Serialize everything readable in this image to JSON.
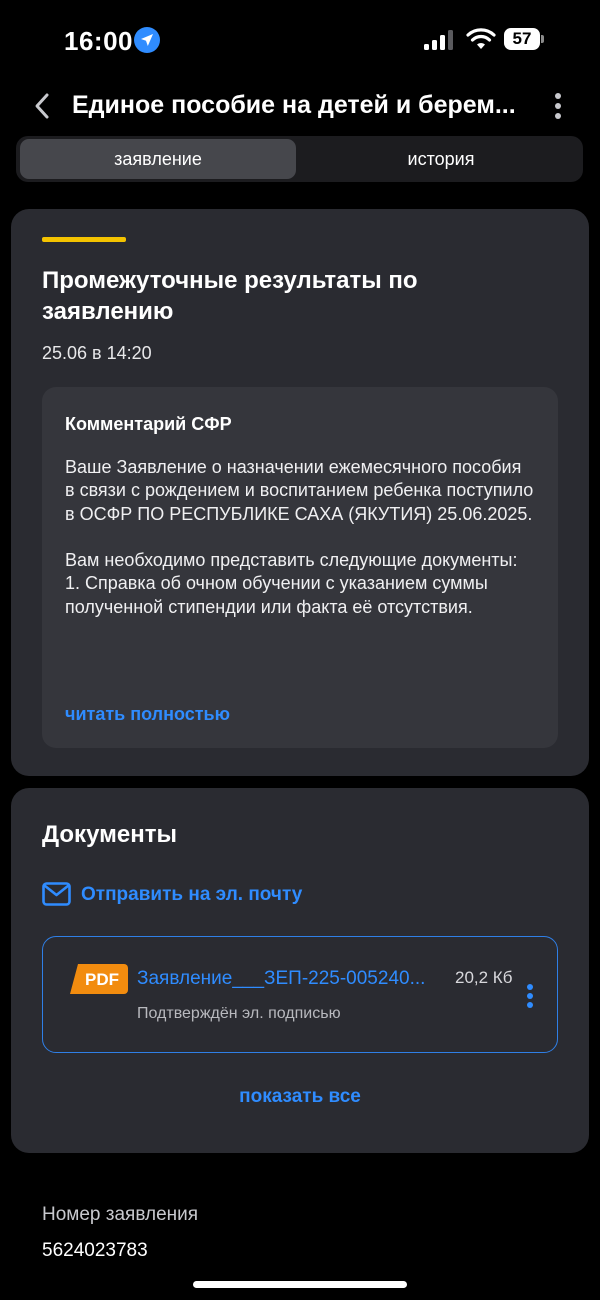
{
  "status_bar": {
    "time": "16:00",
    "battery": "57",
    "icons": [
      "location-arrow-icon",
      "signal-icon",
      "wifi-icon",
      "battery-icon"
    ]
  },
  "header": {
    "title": "Единое пособие на детей и берем...",
    "icons": [
      "chevron-left-icon",
      "more-vertical-icon"
    ]
  },
  "tabs": [
    {
      "label": "заявление",
      "active": true
    },
    {
      "label": "история",
      "active": false
    }
  ],
  "status_card": {
    "accent_color": "#f4c300",
    "title": "Промежуточные результаты по заявлению",
    "date": "25.06 в 14:20",
    "comment": {
      "title": "Комментарий СФР",
      "text": "Ваше Заявление о назначении ежемесячного пособия в связи с рождением и воспитанием ребенка поступило в ОСФР ПО РЕСПУБЛИКЕ САХА (ЯКУТИЯ) 25.06.2025.\n\nВам необходимо представить следующие документы:\n1. Справка об очном обучении с указанием суммы полученной стипендии или факта её отсутствия.",
      "read_more": "читать полностью"
    }
  },
  "documents": {
    "title": "Документы",
    "send_email": "Отправить на эл. почту",
    "file": {
      "badge": "PDF",
      "name": "Заявление___ЗЕП-225-005240...",
      "size": "20,2 Кб",
      "status": "Подтверждён эл. подписью"
    },
    "show_all": "показать все"
  },
  "application": {
    "label": "Номер заявления",
    "value": "5624023783"
  },
  "colors": {
    "background": "#000000",
    "card": "#2a2b31",
    "link": "#2f8cff",
    "pdf_badge": "#f28c0f"
  }
}
